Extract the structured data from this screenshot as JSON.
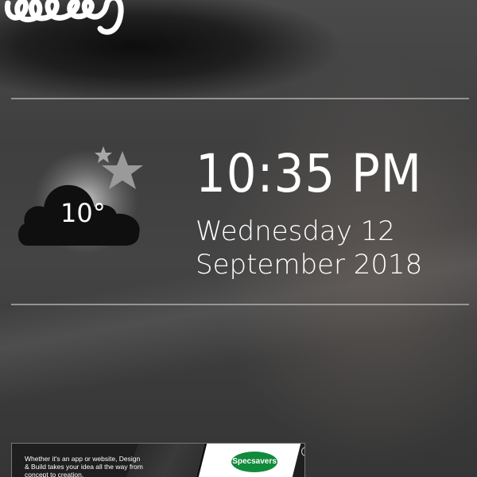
{
  "logo": {
    "icon": "brand-logo-script",
    "color": "#ffffff"
  },
  "weather": {
    "temperature": "10°",
    "icon": "night-cloud-stars-icon"
  },
  "clock": {
    "time": "10:35 PM",
    "date_line1": "Wednesday 12",
    "date_line2": "September 2018"
  },
  "ad": {
    "text": "Whether it's an app or website, Design & Build takes your idea all the way from concept to creation.",
    "brand": "Specsavers",
    "info_icon": "i",
    "brand_color": "#118a3c"
  }
}
